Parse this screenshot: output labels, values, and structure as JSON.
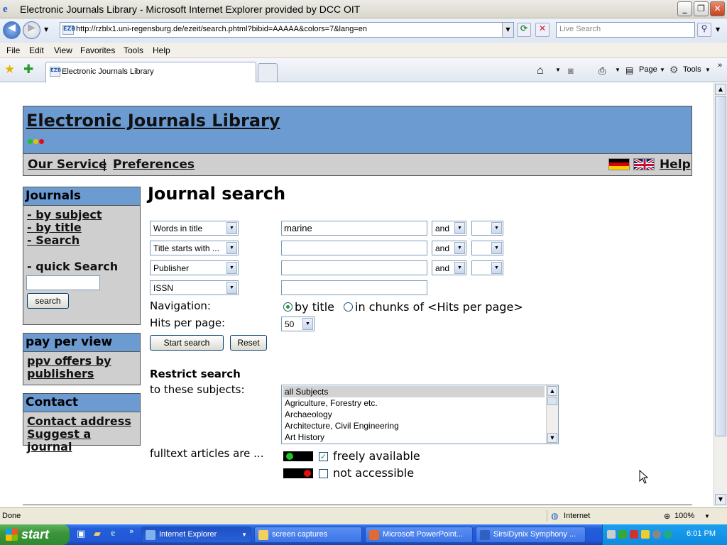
{
  "window": {
    "title": "Electronic Journals Library - Microsoft Internet Explorer provided by DCC OIT"
  },
  "browser": {
    "url": "http://rzblx1.uni-regensburg.de/ezeit/search.phtml?bibid=AAAAA&colors=7&lang=en",
    "search_placeholder": "Live Search",
    "menu": [
      "File",
      "Edit",
      "View",
      "Favorites",
      "Tools",
      "Help"
    ],
    "tab_title": "Electronic Journals Library",
    "toolbar": {
      "page": "Page",
      "tools": "Tools"
    },
    "status": "Done",
    "zone": "Internet",
    "zoom": "100%"
  },
  "site": {
    "title": "Electronic Journals Library",
    "nav": {
      "service": "Our Service",
      "sep": "|",
      "preferences": "Preferences",
      "help": "Help"
    },
    "sidebar": {
      "journals": {
        "heading": "Journals",
        "links": [
          "- by subject",
          "- by title",
          "- Search"
        ],
        "quick_search_label": "- quick Search",
        "search_button": "search"
      },
      "ppv": {
        "heading": "pay per view",
        "link": "ppv offers by publishers"
      },
      "contact": {
        "heading": "Contact",
        "links": [
          "Contact address",
          "Suggest a journal"
        ]
      }
    }
  },
  "search": {
    "heading": "Journal search",
    "rows": [
      {
        "field": "Words in title",
        "value": "marine",
        "op": "and",
        "op2": ""
      },
      {
        "field": "Title starts with ...",
        "value": "",
        "op": "and",
        "op2": ""
      },
      {
        "field": "Publisher",
        "value": "",
        "op": "and",
        "op2": ""
      },
      {
        "field": "ISSN",
        "value": ""
      }
    ],
    "navigation_label": "Navigation:",
    "nav_opt1": "by title",
    "nav_opt2": "in chunks of <Hits per page>",
    "hits_label": "Hits per page:",
    "hits_value": "50",
    "start_button": "Start search",
    "reset_button": "Reset",
    "restrict_heading": "Restrict search",
    "restrict_sub": "to these subjects:",
    "subjects": [
      "all Subjects",
      "Agriculture, Forestry etc.",
      "Archaeology",
      "Architecture, Civil Engineering",
      "Art History"
    ],
    "fulltext_label": "fulltext articles are ...",
    "avail_free": "freely available",
    "avail_none": "not accessible",
    "free_checked": true
  },
  "taskbar": {
    "start": "start",
    "tasks": [
      "Internet Explorer",
      "screen captures",
      "Microsoft PowerPoint...",
      "SirsiDynix Symphony ..."
    ],
    "clock": "6:01 PM"
  },
  "colors": {
    "header_blue": "#6c9bd2",
    "panel_gray": "#cfcfcf",
    "green": "#21a121",
    "red": "#e01010"
  }
}
